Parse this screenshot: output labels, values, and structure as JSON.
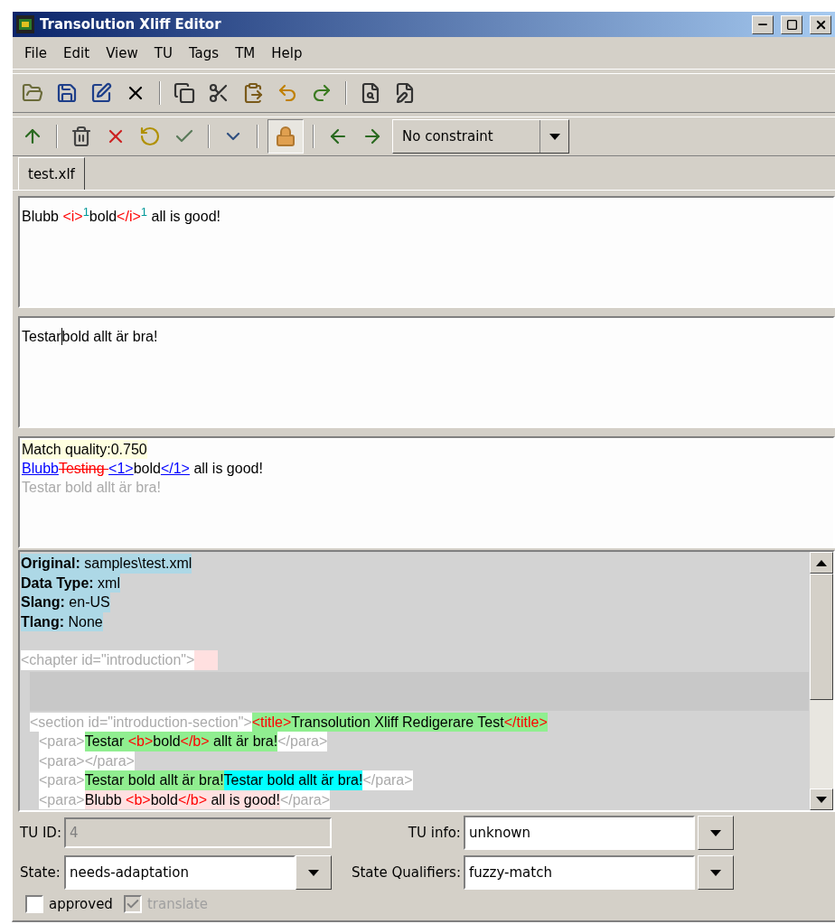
{
  "window": {
    "title": "Transolution Xliff Editor"
  },
  "menu": [
    {
      "label": "File"
    },
    {
      "label": "Edit"
    },
    {
      "label": "View"
    },
    {
      "label": "TU"
    },
    {
      "label": "Tags"
    },
    {
      "label": "TM"
    },
    {
      "label": "Help"
    }
  ],
  "toolbar": {
    "lock_pressed": true,
    "constraint": {
      "value": "No constraint"
    }
  },
  "tabs": [
    {
      "label": "test.xlf",
      "selected": true
    }
  ],
  "source": {
    "runs": [
      {
        "kind": "text",
        "text": "Blubb "
      },
      {
        "kind": "tag",
        "text": "<i>"
      },
      {
        "kind": "marker",
        "text": "1"
      },
      {
        "kind": "text",
        "text": "bold"
      },
      {
        "kind": "tag",
        "text": "</i>"
      },
      {
        "kind": "marker",
        "text": "1"
      },
      {
        "kind": "text",
        "text": " all is good!"
      }
    ]
  },
  "target": {
    "runs": [
      {
        "kind": "text",
        "text": "Testar"
      },
      {
        "kind": "caret"
      },
      {
        "kind": "text",
        "text": "bold allt är bra!"
      }
    ]
  },
  "match": {
    "quality": "Match quality:0.750",
    "diff": [
      {
        "kind": "inserted",
        "text": "Blubb"
      },
      {
        "kind": "deleted",
        "text": "Testing "
      },
      {
        "kind": "inserted",
        "text": "<1>"
      },
      {
        "kind": "text",
        "text": "bold"
      },
      {
        "kind": "inserted",
        "text": "</1>"
      },
      {
        "kind": "text",
        "text": " all is good!"
      }
    ],
    "translation": "Testar bold allt är bra!"
  },
  "document": {
    "meta": [
      {
        "label": "Original:",
        "value": "samples\\test.xml"
      },
      {
        "label": "Data Type:",
        "value": "xml"
      },
      {
        "label": "Slang:",
        "value": "en-US"
      },
      {
        "label": "Tlang:",
        "value": "None"
      }
    ],
    "lines": [
      {
        "kind": "element",
        "parts": [
          {
            "kind": "markup",
            "runs": [
              {
                "kind": "text",
                "text": "<chapter id=\"introduction\">"
              }
            ]
          },
          {
            "kind": "untranslated",
            "runs": [
              {
                "kind": "gap"
              }
            ]
          }
        ],
        "children": [
          {
            "kind": "blank"
          },
          {
            "kind": "element",
            "parts": [
              {
                "kind": "markup",
                "runs": [
                  {
                    "kind": "text",
                    "text": "<section id=\"introduction-section\">"
                  }
                ]
              },
              {
                "kind": "translated",
                "runs": [
                  {
                    "kind": "tag",
                    "text": "<title>"
                  },
                  {
                    "kind": "text",
                    "text": "Transolution Xliff Redigerare Test"
                  },
                  {
                    "kind": "tag",
                    "text": "</title>"
                  }
                ]
              }
            ],
            "children": [
              {
                "kind": "element",
                "parts": [
                  {
                    "kind": "markup",
                    "runs": [
                      {
                        "kind": "text",
                        "text": "<para>"
                      }
                    ]
                  },
                  {
                    "kind": "translated",
                    "runs": [
                      {
                        "kind": "text",
                        "text": "Testar "
                      },
                      {
                        "kind": "tag",
                        "text": "<b>"
                      },
                      {
                        "kind": "text",
                        "text": "bold"
                      },
                      {
                        "kind": "tag",
                        "text": "</b>"
                      },
                      {
                        "kind": "text",
                        "text": " allt är bra!"
                      }
                    ]
                  },
                  {
                    "kind": "markup",
                    "runs": [
                      {
                        "kind": "text",
                        "text": "</para>"
                      }
                    ]
                  }
                ]
              },
              {
                "kind": "element",
                "parts": [
                  {
                    "kind": "markup",
                    "runs": [
                      {
                        "kind": "text",
                        "text": "<para></para>"
                      }
                    ]
                  }
                ]
              },
              {
                "kind": "element",
                "parts": [
                  {
                    "kind": "markup",
                    "runs": [
                      {
                        "kind": "text",
                        "text": "<para>"
                      }
                    ]
                  },
                  {
                    "kind": "translated",
                    "runs": [
                      {
                        "kind": "text",
                        "text": "Testar bold allt är bra!"
                      }
                    ]
                  },
                  {
                    "kind": "fuzzy",
                    "runs": [
                      {
                        "kind": "text",
                        "text": "Testar bold allt är bra!"
                      }
                    ]
                  },
                  {
                    "kind": "markup",
                    "runs": [
                      {
                        "kind": "text",
                        "text": "</para>"
                      }
                    ]
                  }
                ]
              },
              {
                "kind": "element",
                "parts": [
                  {
                    "kind": "markup",
                    "runs": [
                      {
                        "kind": "text",
                        "text": "<para>"
                      }
                    ]
                  },
                  {
                    "kind": "untranslated",
                    "runs": [
                      {
                        "kind": "text",
                        "text": "Blubb "
                      },
                      {
                        "kind": "tag",
                        "text": "<b>"
                      },
                      {
                        "kind": "text",
                        "text": "bold"
                      },
                      {
                        "kind": "tag",
                        "text": "</b>"
                      },
                      {
                        "kind": "text",
                        "text": " all is good!"
                      }
                    ]
                  },
                  {
                    "kind": "markup",
                    "runs": [
                      {
                        "kind": "text",
                        "text": "</para>"
                      }
                    ]
                  }
                ]
              }
            ]
          }
        ]
      }
    ]
  },
  "form": {
    "tu_id": {
      "label": "TU ID:",
      "value": "4",
      "disabled": true
    },
    "tu_info": {
      "label": "TU info:",
      "value": "unknown"
    },
    "state": {
      "label": "State:",
      "value": "needs-adaptation"
    },
    "state_qualifiers": {
      "label": "State Qualifiers:",
      "value": "fuzzy-match"
    },
    "checkboxes": [
      {
        "label": "approved",
        "checked": false,
        "disabled": false
      },
      {
        "label": "translate",
        "checked": true,
        "disabled": true
      }
    ]
  }
}
